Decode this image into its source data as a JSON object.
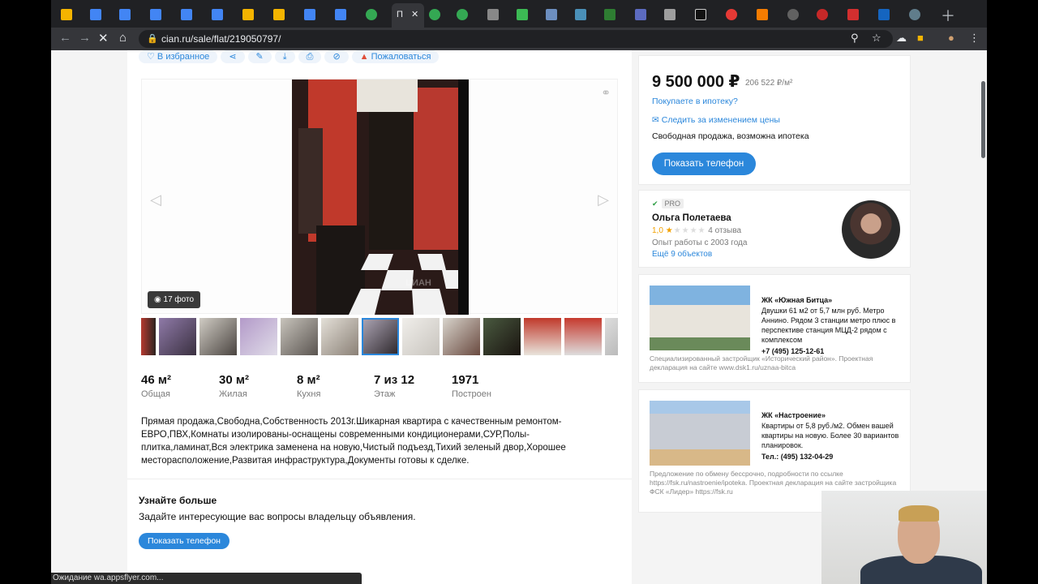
{
  "browser": {
    "active_tab_label": "П",
    "url": "cian.ru/sale/flat/219050797/",
    "status_text": "Ожидание wa.appsflyer.com..."
  },
  "actions": {
    "favorite": "В избранное",
    "report": "Пожаловаться"
  },
  "gallery": {
    "photo_count": "17 фото",
    "watermark": "ЦИАН"
  },
  "specs": [
    {
      "value": "46 м²",
      "label": "Общая"
    },
    {
      "value": "30 м²",
      "label": "Жилая"
    },
    {
      "value": "8 м²",
      "label": "Кухня"
    },
    {
      "value": "7 из 12",
      "label": "Этаж"
    },
    {
      "value": "1971",
      "label": "Построен"
    }
  ],
  "description": "Прямая продажа,Свободна,Собственность 2013г.Шикарная квартира с качественным ремонтом-ЕВРО,ПВХ,Комнаты изолированы-оснащены современными кондиционерами,СУР,Полы-плитка,ламинат,Вся электрика заменена на новую,Чистый подъезд,Тихий зеленый двор,Хорошее месторасположение,Развитая инфраструктура,Документы готовы к сделке.",
  "learn_more": {
    "title": "Узнайте больше",
    "subtitle": "Задайте интересующие вас вопросы владельцу объявления.",
    "button": "Показать телефон"
  },
  "price_card": {
    "price": "9 500 000 ₽",
    "per_m2": "206 522 ₽/м²",
    "mortgage": "Покупаете в ипотеку?",
    "track": "Следить за изменением цены",
    "sale_type": "Свободная продажа, возможна ипотека",
    "button": "Показать телефон"
  },
  "agent": {
    "badge": "PRO",
    "name": "Ольга Полетаева",
    "rating": "1,0",
    "reviews": "4 отзыва",
    "experience": "Опыт работы с 2003 года",
    "objects": "Ещё 9 объектов"
  },
  "ads": [
    {
      "title": "ЖК «Южная Битца»",
      "text": "Двушки 61 м2 от 5,7 млн руб. Метро Аннино. Рядом 3 станции метро плюс в перспективе станция МЦД-2 рядом с комплексом",
      "phone": "+7 (495) 125-12-61",
      "footer": "Специализированный застройщик «Исторический район». Проектная декларация на сайте www.dsk1.ru/uznaa-bitca"
    },
    {
      "title": "ЖК «Настроение»",
      "text": "Квартиры от 5,8 руб./м2. Обмен вашей квартиры на новую. Более 30 вариантов планировок.",
      "phone": "Тел.: (495) 132-04-29",
      "footer": "Предложение по обмену бессрочно, подробности по ссылке https://fsk.ru/nastroenie/ipoteka. Проектная декларация на сайте застройщика ФСК «Лидер» https://fsk.ru"
    }
  ],
  "colors": {
    "accent": "#2b87db",
    "text": "#121212",
    "muted": "#7a7a7a"
  }
}
